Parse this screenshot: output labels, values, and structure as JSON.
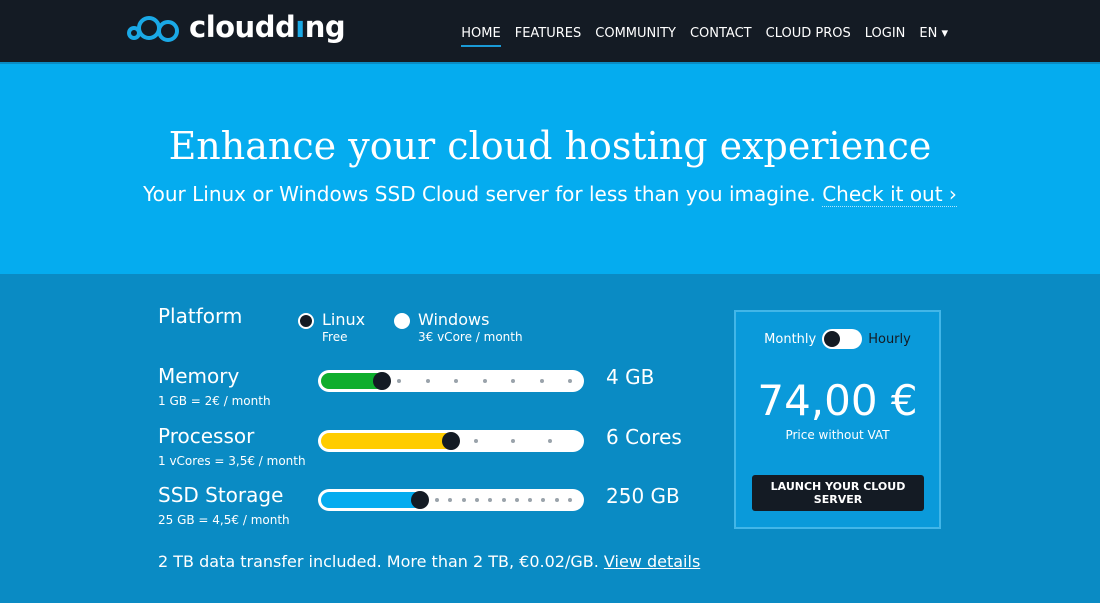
{
  "brand": {
    "name_pre": "cloud",
    "name_i": "i",
    "name_post": "ng"
  },
  "nav": {
    "items": [
      {
        "label": "HOME",
        "active": true
      },
      {
        "label": "FEATURES"
      },
      {
        "label": "COMMUNITY"
      },
      {
        "label": "CONTACT"
      },
      {
        "label": "CLOUD PROS"
      },
      {
        "label": "LOGIN"
      },
      {
        "label": "EN ▾"
      }
    ]
  },
  "hero": {
    "title": "Enhance your cloud hosting experience",
    "subtitle": "Your Linux or Windows SSD Cloud server for less than you imagine. ",
    "link": "Check it out ›"
  },
  "config": {
    "platform": {
      "label": "Platform",
      "options": [
        {
          "label": "Linux",
          "sub": "Free",
          "selected": true
        },
        {
          "label": "Windows",
          "sub": "3€ vCore / month",
          "selected": false
        }
      ]
    },
    "sliders": [
      {
        "label": "Memory",
        "sub": "1 GB = 2€ / month",
        "value": "4 GB",
        "color": "#0fae2e",
        "position": 1,
        "steps": 8
      },
      {
        "label": "Processor",
        "sub": "1 vCores = 3,5€ / month",
        "value": "6 Cores",
        "color": "#ffcc00",
        "position": 3,
        "steps": 7
      },
      {
        "label": "SSD Storage",
        "sub": "25 GB = 4,5€ / month",
        "value": "250 GB",
        "color": "#05acef",
        "position": 9,
        "steps": 21
      }
    ],
    "transfer_text": "2 TB data transfer included. More than 2 TB, €0.02/GB. ",
    "transfer_link": "View details"
  },
  "pricing": {
    "monthly": "Monthly",
    "hourly": "Hourly",
    "price": "74,00 €",
    "note": "Price without VAT",
    "cta": "LAUNCH YOUR CLOUD SERVER"
  }
}
